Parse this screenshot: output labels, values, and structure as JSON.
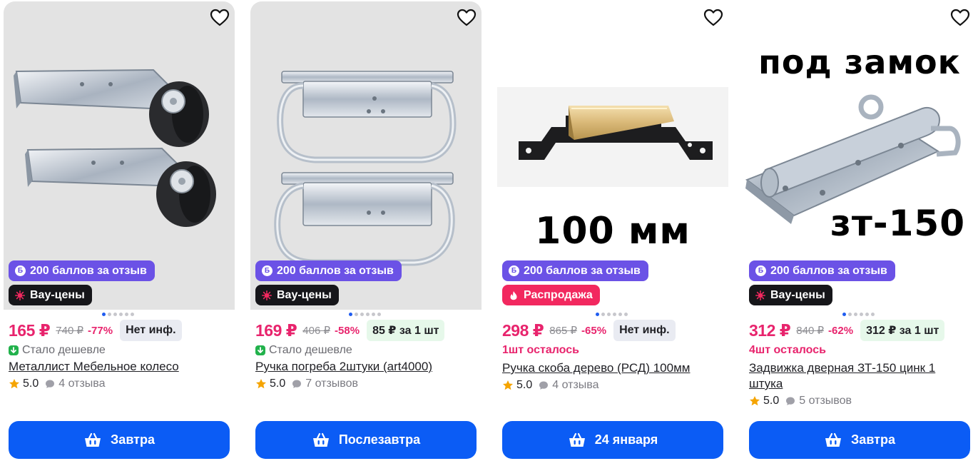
{
  "products": [
    {
      "title": "Металлист Мебельное колесо",
      "price": "165 ₽",
      "old_price": "740 ₽",
      "discount": "-77%",
      "chip": "Нет инф.",
      "chip_style": "gray",
      "points_badge": "200 баллов за отзыв",
      "points_icon_letter": "Б",
      "promo_badge": "Вау-цены",
      "promo_style": "dark",
      "extra_line": "Стало дешевле",
      "extra_type": "cheaper",
      "rating": "5.0",
      "reviews": "4 отзыва",
      "delivery": "Завтра",
      "image_icon": "furniture-wheel-image",
      "image_bg": "gray",
      "slides_total": 6,
      "slide_active": 0
    },
    {
      "title": "Ручка погреба 2штуки (art4000)",
      "price": "169 ₽",
      "old_price": "406 ₽",
      "discount": "-58%",
      "chip": "85 ₽ за 1 шт",
      "chip_style": "green",
      "points_badge": "200 баллов за отзыв",
      "points_icon_letter": "Б",
      "promo_badge": "Вау-цены",
      "promo_style": "dark",
      "extra_line": "Стало дешевле",
      "extra_type": "cheaper",
      "rating": "5.0",
      "reviews": "7 отзывов",
      "delivery": "Послезавтра",
      "image_icon": "cellar-handle-image",
      "image_bg": "gray",
      "slides_total": 6,
      "slide_active": 0
    },
    {
      "title": "Ручка скоба дерево (РСД) 100мм",
      "price": "298 ₽",
      "old_price": "865 ₽",
      "discount": "-65%",
      "chip": "Нет инф.",
      "chip_style": "gray",
      "points_badge": "200 баллов за отзыв",
      "points_icon_letter": "Б",
      "promo_badge": "Распродажа",
      "promo_style": "pink",
      "extra_line": "1шт осталось",
      "extra_type": "stock",
      "rating": "5.0",
      "reviews": "4 отзыва",
      "delivery": "24 января",
      "image_icon": "wood-handle-image",
      "image_bg": "white",
      "image_text": "100 мм",
      "slides_total": 6,
      "slide_active": 0
    },
    {
      "title": "Задвижка дверная ЗТ-150 цинк 1 штука",
      "price": "312 ₽",
      "old_price": "840 ₽",
      "discount": "-62%",
      "chip": "312 ₽ за 1 шт",
      "chip_style": "green",
      "points_badge": "200 баллов за отзыв",
      "points_icon_letter": "Б",
      "promo_badge": "Вау-цены",
      "promo_style": "dark",
      "extra_line": "4шт осталось",
      "extra_type": "stock",
      "rating": "5.0",
      "reviews": "5 отзывов",
      "delivery": "Завтра",
      "image_icon": "door-bolt-image",
      "image_bg": "white",
      "image_text_top": "под замок",
      "image_text_bottom": "зт-150",
      "slides_total": 6,
      "slide_active": 0
    }
  ],
  "colors": {
    "price": "#e8246d",
    "points_badge": "#6b52e6",
    "promo_dark": "#16161a",
    "promo_pink": "#f2285f",
    "button": "#0b5cf5",
    "star": "#f5a400",
    "cheaper_icon": "#22b24c",
    "active_dot": "#1f5cf0"
  },
  "icons": {
    "favorite": "heart-outline-icon",
    "points": "points-b-icon",
    "promo_wow": "sparkle-icon",
    "promo_sale": "fire-icon",
    "cheaper": "arrow-down-icon",
    "rating": "star-icon",
    "reviews": "speech-bubble-icon",
    "delivery": "basket-icon"
  }
}
